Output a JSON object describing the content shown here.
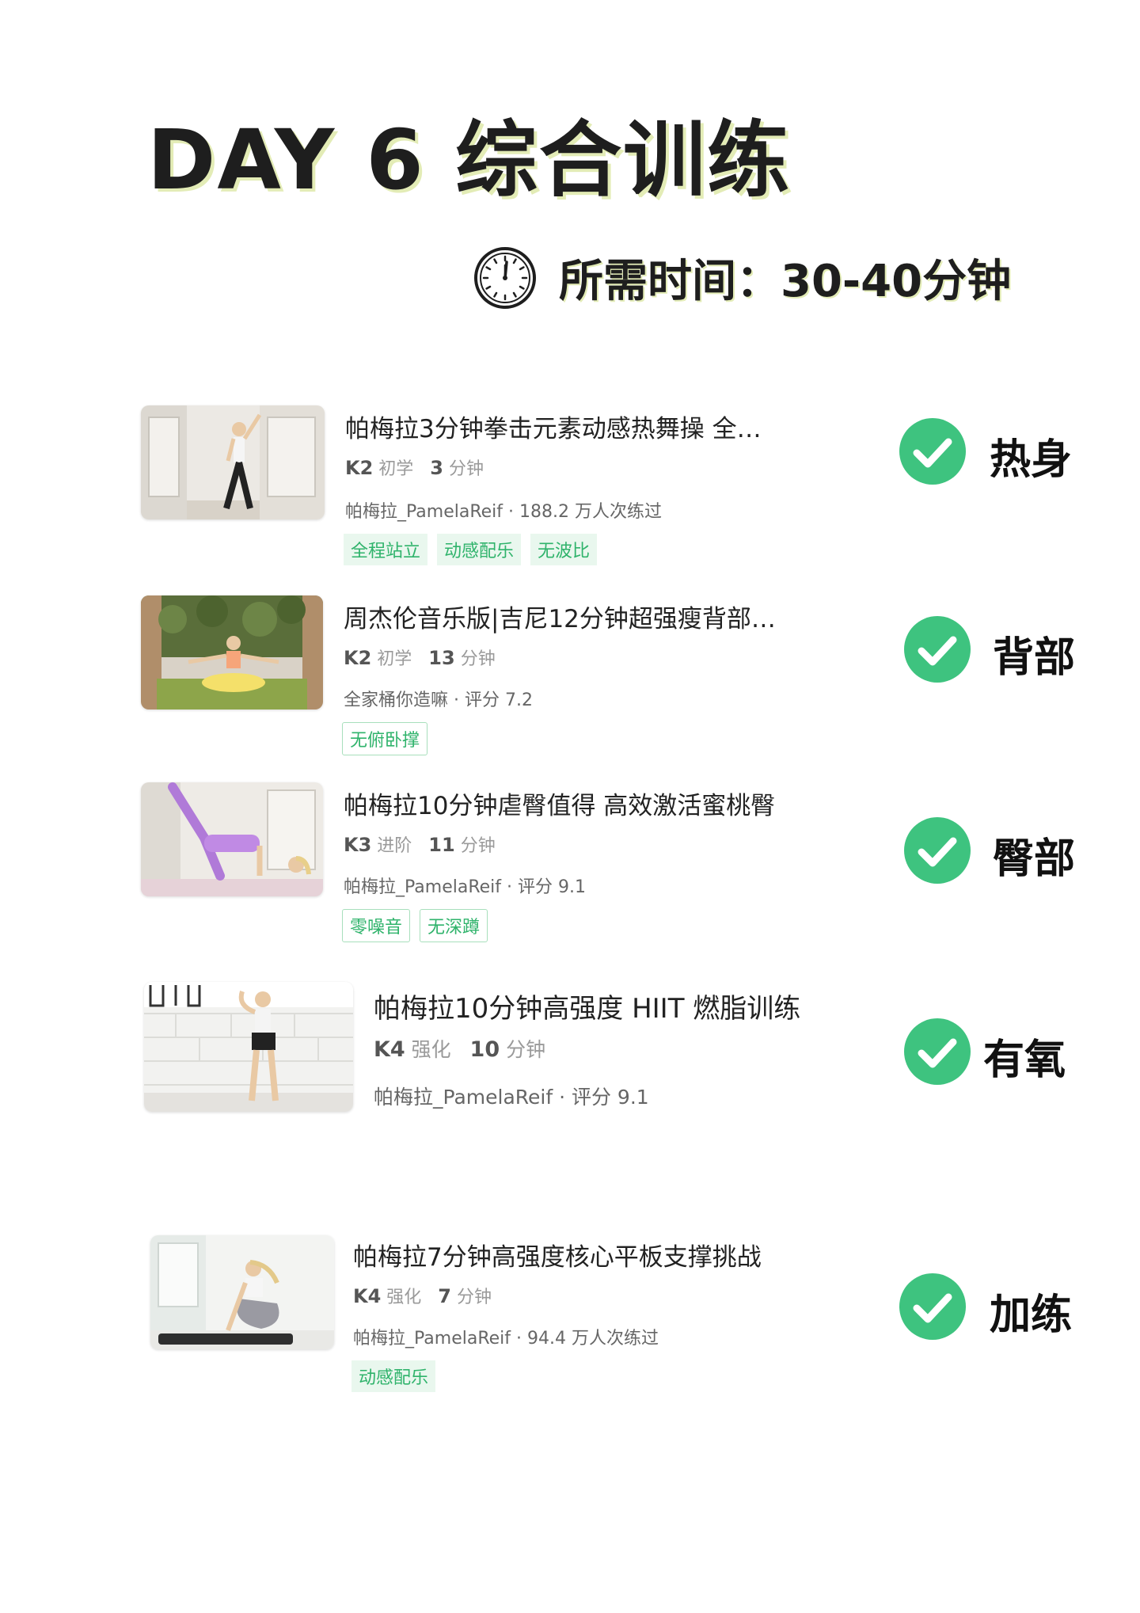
{
  "header": {
    "title": "DAY 6 综合训练",
    "duration": "所需时间：30-40分钟"
  },
  "items": [
    {
      "title": "帕梅拉3分钟拳击元素动感热舞操 全…",
      "level": "K2",
      "difficulty": "初学",
      "minutes": "3",
      "unit": "分钟",
      "subline": "帕梅拉_PamelaReif · 188.2 万人次练过",
      "tags": [
        "全程站立",
        "动感配乐",
        "无波比"
      ],
      "category": "热身"
    },
    {
      "title": "周杰伦音乐版|吉尼12分钟超强瘦背部…",
      "level": "K2",
      "difficulty": "初学",
      "minutes": "13",
      "unit": "分钟",
      "subline": "全家桶你造嘛 · 评分 7.2",
      "tags": [
        "无俯卧撑"
      ],
      "category": "背部"
    },
    {
      "title": "帕梅拉10分钟虐臀值得 高效激活蜜桃臀",
      "level": "K3",
      "difficulty": "进阶",
      "minutes": "11",
      "unit": "分钟",
      "subline": "帕梅拉_PamelaReif · 评分 9.1",
      "tags": [
        "零噪音",
        "无深蹲"
      ],
      "category": "臀部"
    },
    {
      "title": "帕梅拉10分钟高强度 HIIT 燃脂训练",
      "level": "K4",
      "difficulty": "强化",
      "minutes": "10",
      "unit": "分钟",
      "subline": "帕梅拉_PamelaReif · 评分 9.1",
      "tags": [],
      "category": "有氧"
    },
    {
      "title": "帕梅拉7分钟高强度核心平板支撑挑战",
      "level": "K4",
      "difficulty": "强化",
      "minutes": "7",
      "unit": "分钟",
      "subline": "帕梅拉_PamelaReif · 94.4 万人次练过",
      "tags": [
        "动感配乐"
      ],
      "category": "加练"
    }
  ],
  "colors": {
    "accent": "#3ec37f",
    "tag_text": "#2fb36b",
    "tag_bg": "#e9f7ee"
  }
}
